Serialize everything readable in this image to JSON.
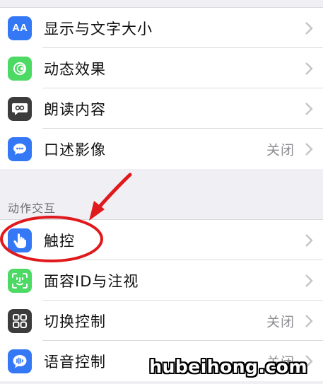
{
  "vision_group": {
    "items": [
      {
        "label": "显示与文字大小",
        "icon": "text-size-icon",
        "color": "#3478f6",
        "value": ""
      },
      {
        "label": "动态效果",
        "icon": "motion-icon",
        "color": "#4cd964",
        "value": ""
      },
      {
        "label": "朗读内容",
        "icon": "speech-icon",
        "color": "#3c3c3c",
        "value": ""
      },
      {
        "label": "口述影像",
        "icon": "audio-description-icon",
        "color": "#3478f6",
        "value": "关闭"
      }
    ]
  },
  "interaction_group": {
    "header": "动作交互",
    "items": [
      {
        "label": "触控",
        "icon": "touch-icon",
        "color": "#3478f6",
        "value": ""
      },
      {
        "label": "面容ID与注视",
        "icon": "face-id-icon",
        "color": "#4cd964",
        "value": ""
      },
      {
        "label": "切换控制",
        "icon": "switch-control-icon",
        "color": "#3c3c3c",
        "value": "关闭"
      },
      {
        "label": "语音控制",
        "icon": "voice-control-icon",
        "color": "#3478f6",
        "value": "关闭"
      }
    ]
  },
  "icons": {
    "text_size_glyph": "AA"
  },
  "annotation": {
    "color": "#e0191c"
  },
  "watermark": "hubeihong.com"
}
